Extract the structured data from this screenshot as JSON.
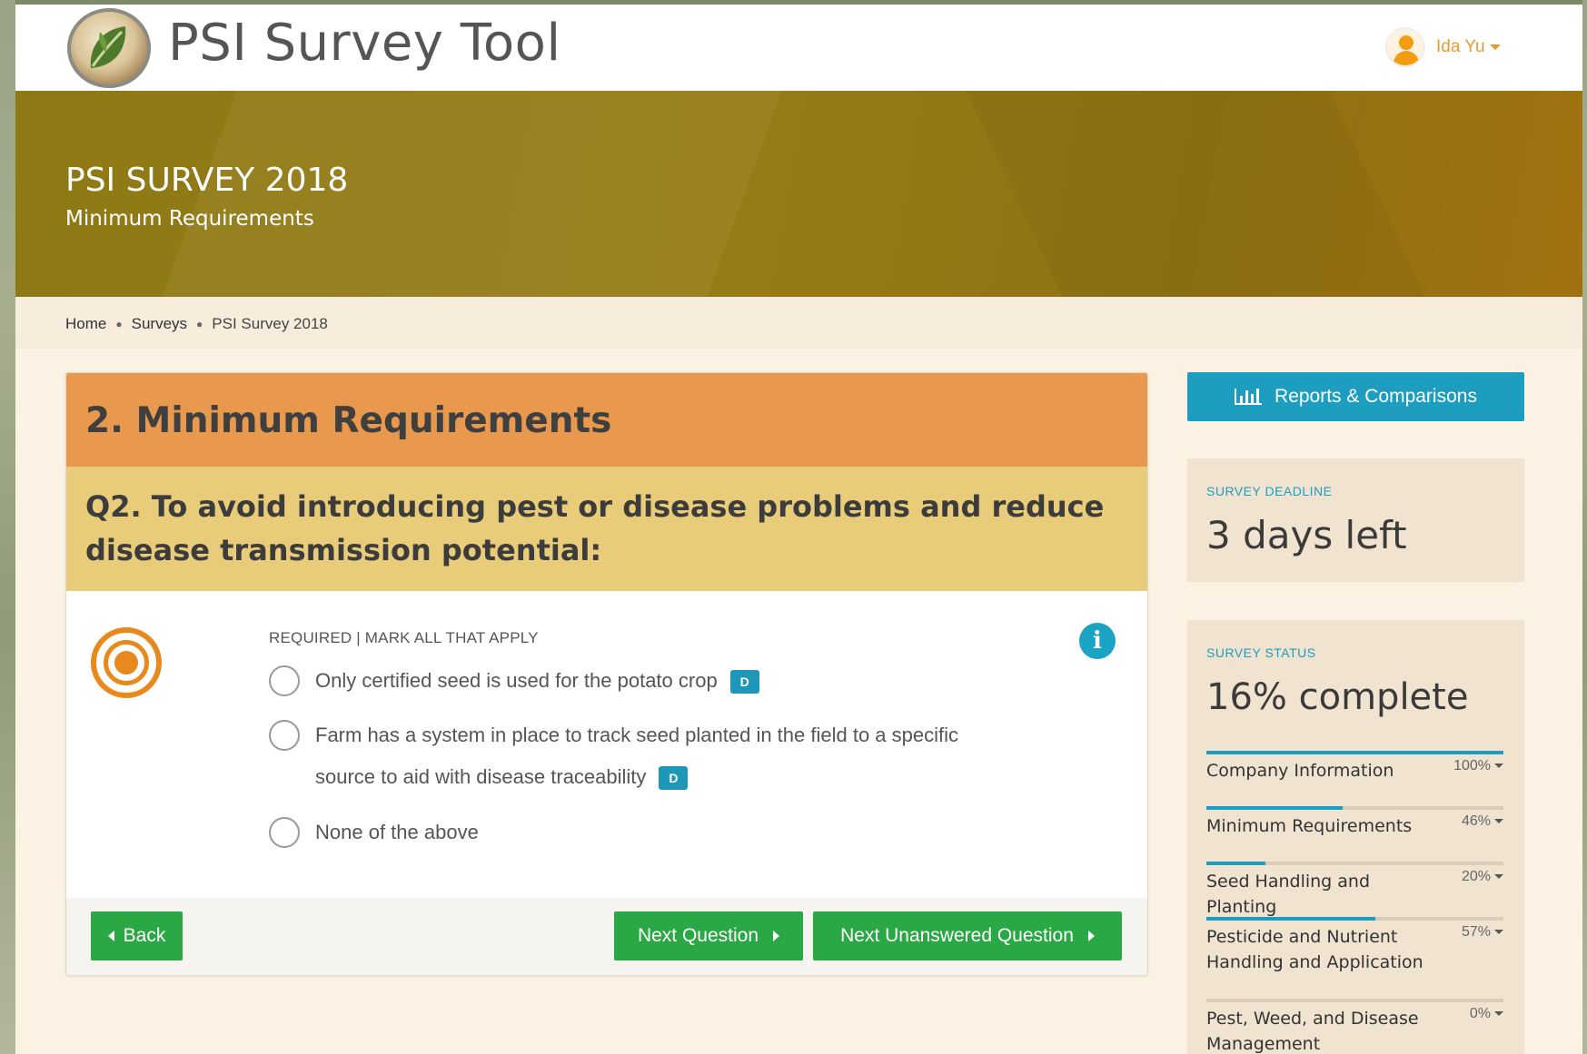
{
  "app": {
    "title": "PSI Survey Tool"
  },
  "user": {
    "name": "Ida Yu"
  },
  "banner": {
    "title": "PSI SURVEY 2018",
    "subtitle": "Minimum Requirements"
  },
  "breadcrumb": [
    "Home",
    "Surveys",
    "PSI Survey 2018"
  ],
  "section": {
    "title": "2. Minimum Requirements"
  },
  "question": {
    "text": "Q2. To avoid introducing pest or disease problems and reduce disease transmission potential:",
    "instruction": "REQUIRED | MARK ALL THAT APPLY",
    "options": [
      {
        "text": "Only certified seed is used for the potato crop",
        "badge": "D"
      },
      {
        "text": "Farm has a system in place to track seed planted in the field to a specific source to aid with disease traceability",
        "badge": "D"
      },
      {
        "text": "None of the above",
        "badge": ""
      }
    ]
  },
  "buttons": {
    "back": "Back",
    "next": "Next Question",
    "next_unanswered": "Next Unanswered Question",
    "reports": "Reports & Comparisons"
  },
  "deadline": {
    "label": "SURVEY DEADLINE",
    "value": "3 days left"
  },
  "status": {
    "label": "SURVEY STATUS",
    "value": "16% complete",
    "sections": [
      {
        "name": "Company Information",
        "percent_label": "100%",
        "progress": 100
      },
      {
        "name": "Minimum Requirements",
        "percent_label": "46%",
        "progress": 46
      },
      {
        "name": "Seed Handling and Planting",
        "percent_label": "20%",
        "progress": 20
      },
      {
        "name": "Pesticide and Nutrient Handling and Application",
        "percent_label": "57%",
        "progress": 57
      },
      {
        "name": "Pest, Weed, and Disease Management",
        "percent_label": "0%",
        "progress": 0
      }
    ]
  },
  "colors": {
    "section_header": "#e8994d",
    "question_header": "#e8cc79",
    "banner": "#977c16",
    "accent": "#1d9dc0",
    "button_green": "#2aa845",
    "target_icon": "#e8891e"
  }
}
